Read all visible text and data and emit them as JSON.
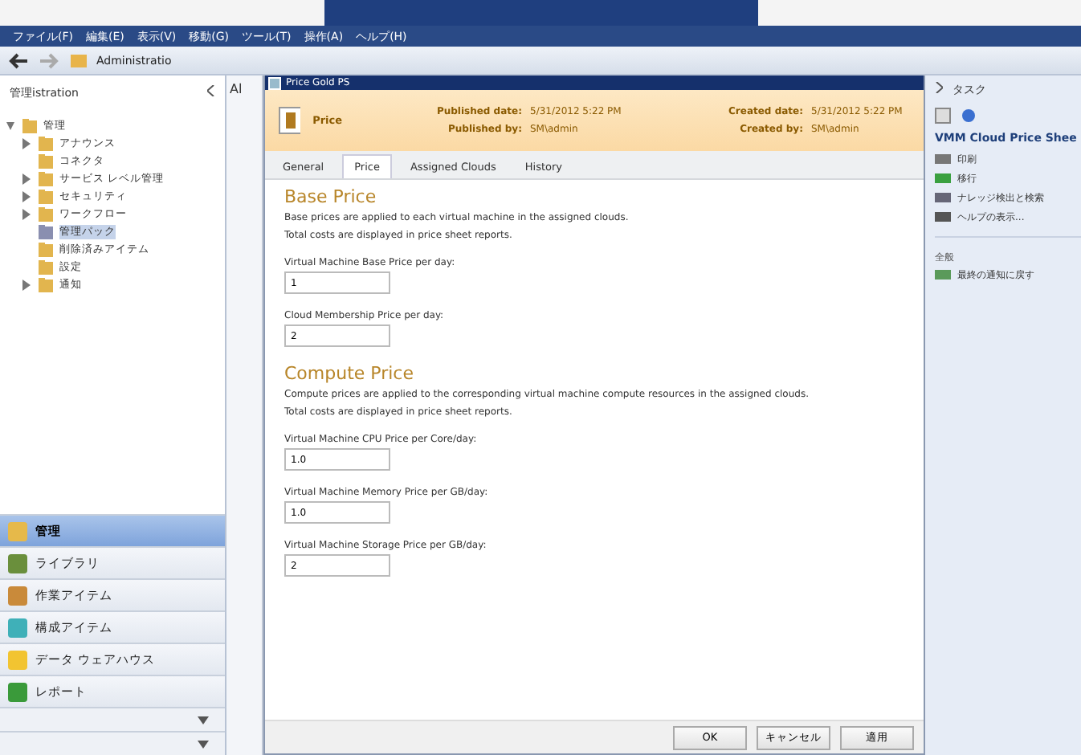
{
  "menu": [
    "ファイル(F)",
    "編集(E)",
    "表示(V)",
    "移動(G)",
    "ツール(T)",
    "操作(A)",
    "ヘルプ(H)"
  ],
  "nav": {
    "path": "Administratio"
  },
  "left_pane": {
    "title": "管理istration",
    "tree": [
      {
        "label": "管理",
        "kind": "branch",
        "selected": false,
        "children": [
          {
            "label": "アナウンス",
            "kind": "branch",
            "selected": false
          },
          {
            "label": "コネクタ",
            "kind": "leaf",
            "selected": false
          },
          {
            "label": "サービス レベル管理",
            "kind": "branch",
            "selected": false
          },
          {
            "label": "セキュリティ",
            "kind": "branch",
            "selected": false
          },
          {
            "label": "ワークフロー",
            "kind": "branch",
            "selected": false
          },
          {
            "label": "管理パック",
            "kind": "leaf",
            "selected": true
          },
          {
            "label": "削除済みアイテム",
            "kind": "leaf",
            "selected": false
          },
          {
            "label": "設定",
            "kind": "leaf",
            "selected": false
          },
          {
            "label": "通知",
            "kind": "branch",
            "selected": false
          }
        ]
      }
    ]
  },
  "wunderbar": [
    {
      "label": "管理",
      "selected": true
    },
    {
      "label": "ライブラリ",
      "selected": false
    },
    {
      "label": "作業アイテム",
      "selected": false
    },
    {
      "label": "構成アイテム",
      "selected": false
    },
    {
      "label": "データ ウェアハウス",
      "selected": false
    },
    {
      "label": "レポート",
      "selected": false
    }
  ],
  "middle_column": {
    "heading": "Al"
  },
  "dialog": {
    "title": "Price Gold PS",
    "name": "Price",
    "meta": [
      {
        "label": "Published date:",
        "value": "5/31/2012 5:22 PM"
      },
      {
        "label": "Created date:",
        "value": "5/31/2012 5:22 PM"
      },
      {
        "label": "Published by:",
        "value": "SM\\admin"
      },
      {
        "label": "Created by:",
        "value": "SM\\admin"
      }
    ],
    "tabs": [
      {
        "label": "General",
        "selected": false
      },
      {
        "label": "Price",
        "selected": true
      },
      {
        "label": "Assigned Clouds",
        "selected": false
      },
      {
        "label": "History",
        "selected": false
      }
    ],
    "sections": [
      {
        "title": "Base Price",
        "description": [
          "Base prices are applied to each virtual machine in the assigned clouds.",
          "Total costs are displayed in price sheet reports."
        ],
        "fields": [
          {
            "label": "Virtual Machine Base Price per day:",
            "value": "1"
          },
          {
            "label": "Cloud Membership Price per day:",
            "value": "2"
          }
        ]
      },
      {
        "title": "Compute Price",
        "description": [
          "Compute prices are applied to the corresponding virtual machine compute resources in the assigned clouds.",
          "Total costs are displayed in price sheet reports."
        ],
        "fields": [
          {
            "label": "Virtual Machine CPU Price per Core/day:",
            "value": "1.0"
          },
          {
            "label": "Virtual Machine Memory Price per GB/day:",
            "value": "1.0"
          },
          {
            "label": "Virtual Machine Storage Price per GB/day:",
            "value": "2"
          }
        ]
      }
    ],
    "buttons": [
      "OK",
      "キャンセル",
      "適用"
    ]
  },
  "tasks": {
    "title": "タスク",
    "heading": "VMM Cloud Price Shee",
    "items": [
      "印刷",
      "移行",
      "ナレッジ検出と検索",
      "ヘルプの表示..."
    ],
    "section": "全般",
    "section_items": [
      "最終の通知に戻す"
    ]
  }
}
